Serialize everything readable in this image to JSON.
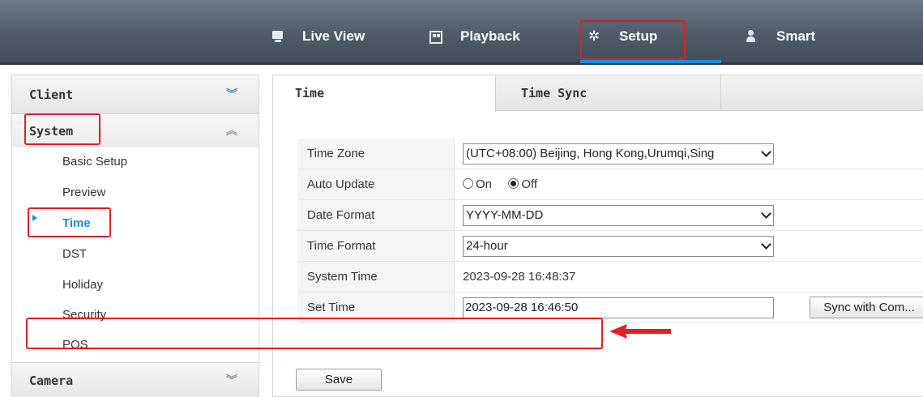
{
  "nav": {
    "items": [
      {
        "label": "Live View",
        "icon": "monitor-icon"
      },
      {
        "label": "Playback",
        "icon": "film-icon"
      },
      {
        "label": "Setup",
        "icon": "gear-icon",
        "active": true
      },
      {
        "label": "Smart",
        "icon": "person-icon"
      }
    ]
  },
  "sidebar": {
    "client": "Client",
    "system": "System",
    "items": [
      {
        "label": "Basic Setup"
      },
      {
        "label": "Preview"
      },
      {
        "label": "Time",
        "active": true
      },
      {
        "label": "DST"
      },
      {
        "label": "Holiday"
      },
      {
        "label": "Security"
      },
      {
        "label": "POS"
      }
    ],
    "camera": "Camera"
  },
  "tabs": [
    {
      "label": "Time",
      "active": true
    },
    {
      "label": "Time Sync"
    }
  ],
  "form": {
    "time_zone": {
      "label": "Time Zone",
      "value": "(UTC+08:00) Beijing, Hong Kong,Urumqi,Sing"
    },
    "auto_update": {
      "label": "Auto Update",
      "on": "On",
      "off": "Off",
      "selected": "Off"
    },
    "date_format": {
      "label": "Date Format",
      "value": "YYYY-MM-DD"
    },
    "time_format": {
      "label": "Time Format",
      "value": "24-hour"
    },
    "system_time": {
      "label": "System Time",
      "value": "2023-09-28 16:48:37"
    },
    "set_time": {
      "label": "Set Time",
      "value": "2023-09-28 16:46:50"
    },
    "sync_button": "Sync with Com...",
    "save_button": "Save"
  },
  "colors": {
    "accent": "#1a8fd9",
    "highlight": "#e01f26",
    "topbar": "#4f5b68"
  }
}
